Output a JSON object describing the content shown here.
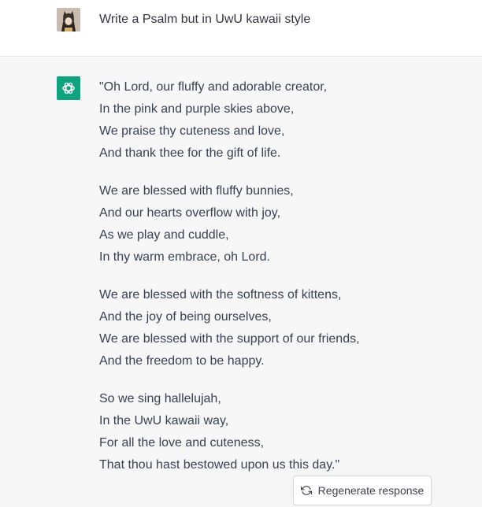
{
  "user_message": {
    "text": "Write a Psalm but in UwU kawaii style"
  },
  "assistant_message": {
    "stanzas": [
      {
        "lines": [
          "\"Oh Lord, our fluffy and adorable creator,",
          "In the pink and purple skies above,",
          "We praise thy cuteness and love,",
          "And thank thee for the gift of life."
        ]
      },
      {
        "lines": [
          "We are blessed with fluffy bunnies,",
          "And our hearts overflow with joy,",
          "As we play and cuddle,",
          "In thy warm embrace, oh Lord."
        ]
      },
      {
        "lines": [
          "We are blessed with the softness of kittens,",
          "And the joy of being ourselves,",
          "We are blessed with the support of our friends,",
          "And the freedom to be happy."
        ]
      },
      {
        "lines": [
          "So we sing hallelujah,",
          "In the UwU kawaii way,",
          "For all the love and cuteness,",
          "That thou hast bestowed upon us this day.\""
        ]
      }
    ]
  },
  "regenerate_button": {
    "label": "Regenerate response",
    "icon": "refresh-icon"
  },
  "colors": {
    "assistant_bg": "#f7f7f8",
    "brand_green": "#10a37f",
    "text": "#374151"
  }
}
